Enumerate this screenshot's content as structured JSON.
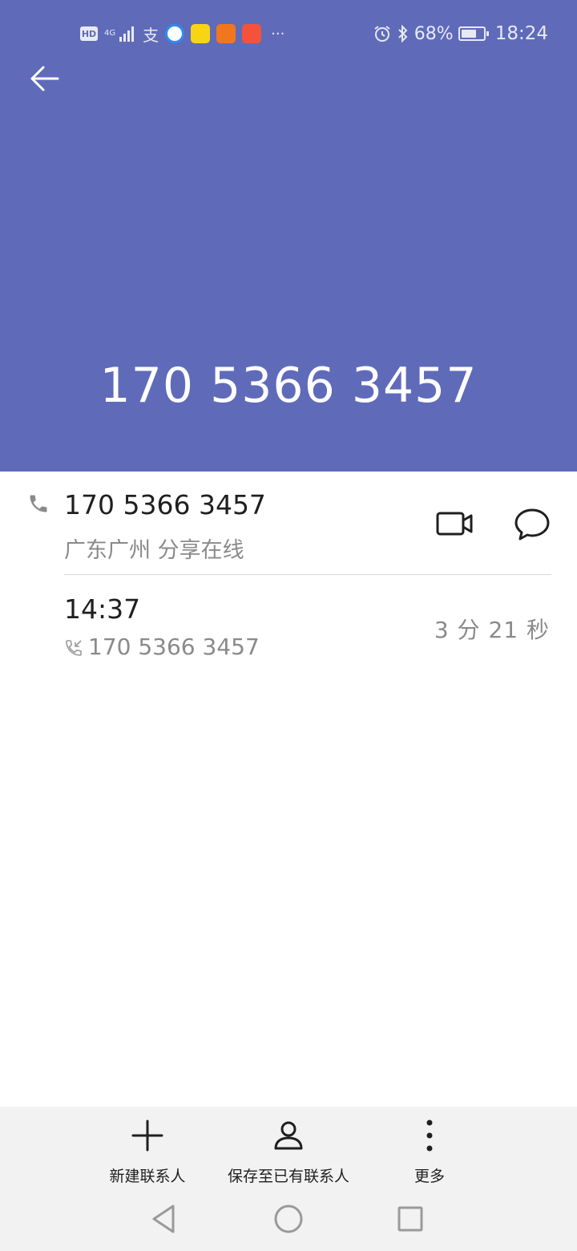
{
  "theme": {
    "accent": "#5f6bb9"
  },
  "status_bar": {
    "hd": "HD",
    "network": "4G",
    "pay_glyph": "支",
    "more_glyph": "···",
    "battery_percent": "68%",
    "battery_level": 0.68,
    "time": "18:24",
    "icons": [
      "hd-icon",
      "signal-icon",
      "alipay-icon",
      "browser-icon",
      "music-icon",
      "uc-browser-icon",
      "taobao-icon",
      "alarm-icon",
      "bluetooth-icon",
      "battery-icon"
    ]
  },
  "header": {
    "number": "170 5366 3457"
  },
  "detail": {
    "number": "170 5366 3457",
    "location": "广东广州 分享在线",
    "icons": [
      "phone-icon",
      "video-call-icon",
      "message-icon"
    ]
  },
  "call_log": [
    {
      "time": "14:37",
      "type_icon": "incoming-call-icon",
      "number": "170 5366 3457",
      "duration": "3 分 21 秒"
    }
  ],
  "actions": {
    "new_contact": "新建联系人",
    "save_existing": "保存至已有联系人",
    "more": "更多"
  },
  "nav": [
    "back-triangle-icon",
    "home-circle-icon",
    "recent-square-icon"
  ]
}
